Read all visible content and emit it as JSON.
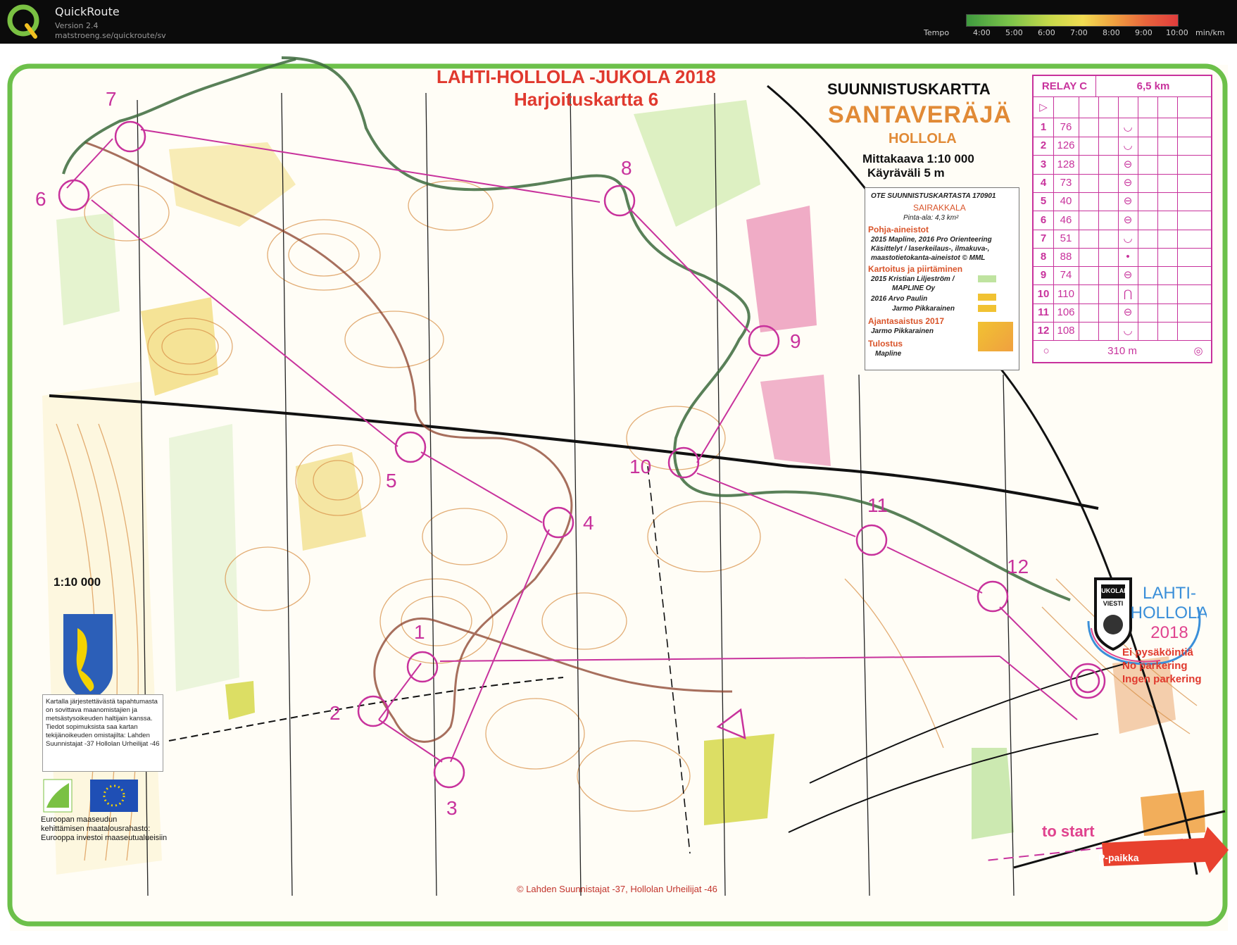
{
  "app": {
    "title": "QuickRoute",
    "version": "Version 2.4",
    "url": "matstroeng.se/quickroute/sv"
  },
  "tempo": {
    "label": "Tempo",
    "ticks": [
      "4:00",
      "5:00",
      "6:00",
      "7:00",
      "8:00",
      "9:00",
      "10:00",
      "min/km"
    ]
  },
  "map": {
    "event_title": "LAHTI-HOLLOLA -JUKOLA 2018",
    "event_subtitle": "Harjoituskartta 6",
    "map_type": "SUUNNISTUSKARTTA",
    "map_name": "SANTAVERÄJÄ",
    "region": "HOLLOLA",
    "scale": "Mittakaava 1:10 000",
    "contour": "Käyräväli 5 m",
    "scale_left": "1:10 000",
    "copyright": "© Lahden Suunnistajat -37, Hollolan Urheilijat -46",
    "no_parking": [
      "Ei pysäköintiä",
      "No parkering",
      "Ingen parkering"
    ],
    "to_start": "to start",
    "p_paikka": "P-paikka",
    "logo_text": [
      "JUKOLAN",
      "VIESTI",
      "LAHTI-",
      "HOLLOLA",
      "2018"
    ]
  },
  "credits": {
    "title": "OTE SUUNNISTUSKARTASTA 170901",
    "sub": "SAIRAKKALA",
    "area": "Pinta-ala: 4,3 km²",
    "h1": "Pohja-aineistot",
    "l1": "2015 Mapline, 2016 Pro Orienteering",
    "l2": "Käsittelyt /      laserkeilaus-, ilmakuva-,",
    "l3": "maastotietokanta-aineistot   © MML",
    "h2": "Kartoitus ja piirtäminen",
    "l4": "2015  Kristian Liljeström /",
    "l5": "MAPLINE Oy",
    "l6": "2016  Arvo Paulin",
    "l7": "Jarmo Pikkarainen",
    "h3": "Ajantasaistus 2017",
    "l8": "Jarmo Pikkarainen",
    "h4": "Tulostus",
    "l9": "Mapline"
  },
  "description": {
    "class": "RELAY C",
    "length": "6,5 km",
    "finish_distance": "310 m",
    "controls": [
      {
        "n": "1",
        "code": "76",
        "symbol": "hollow-U"
      },
      {
        "n": "2",
        "code": "126",
        "symbol": "hollow-U"
      },
      {
        "n": "3",
        "code": "128",
        "symbol": "pit"
      },
      {
        "n": "4",
        "code": "73",
        "symbol": "pit"
      },
      {
        "n": "5",
        "code": "40",
        "symbol": "pit"
      },
      {
        "n": "6",
        "code": "46",
        "symbol": "pit"
      },
      {
        "n": "7",
        "code": "51",
        "symbol": "hollow-U"
      },
      {
        "n": "8",
        "code": "88",
        "symbol": "dot"
      },
      {
        "n": "9",
        "code": "74",
        "symbol": "pit"
      },
      {
        "n": "10",
        "code": "110",
        "symbol": "knoll"
      },
      {
        "n": "11",
        "code": "106",
        "symbol": "pit"
      },
      {
        "n": "12",
        "code": "108",
        "symbol": "hollow-U"
      }
    ]
  },
  "legal": "Kartalla järjestettävästä tapahtumasta on sovittava maanomistajien ja metsästysoikeuden haltijain kanssa. Tiedot sopimuksista saa kartan tekijänoikeuden omistajilta: Lahden Suunnistajat -37 Hollolan Urheilijat -46",
  "eu_text": [
    "Euroopan maaseudun",
    "kehittämisen maatalousrahasto:",
    "Eurooppa investoi maaseutualueisiin"
  ],
  "course": {
    "controls": [
      "1",
      "2",
      "3",
      "4",
      "5",
      "6",
      "7",
      "8",
      "9",
      "10",
      "11",
      "12"
    ]
  },
  "colors": {
    "course": "#c8329c",
    "frame": "#6cc04a",
    "route": "#3c6a3c",
    "contour": "#d9924a",
    "yellow": "#f1d84f",
    "green": "#bfe3a0"
  }
}
